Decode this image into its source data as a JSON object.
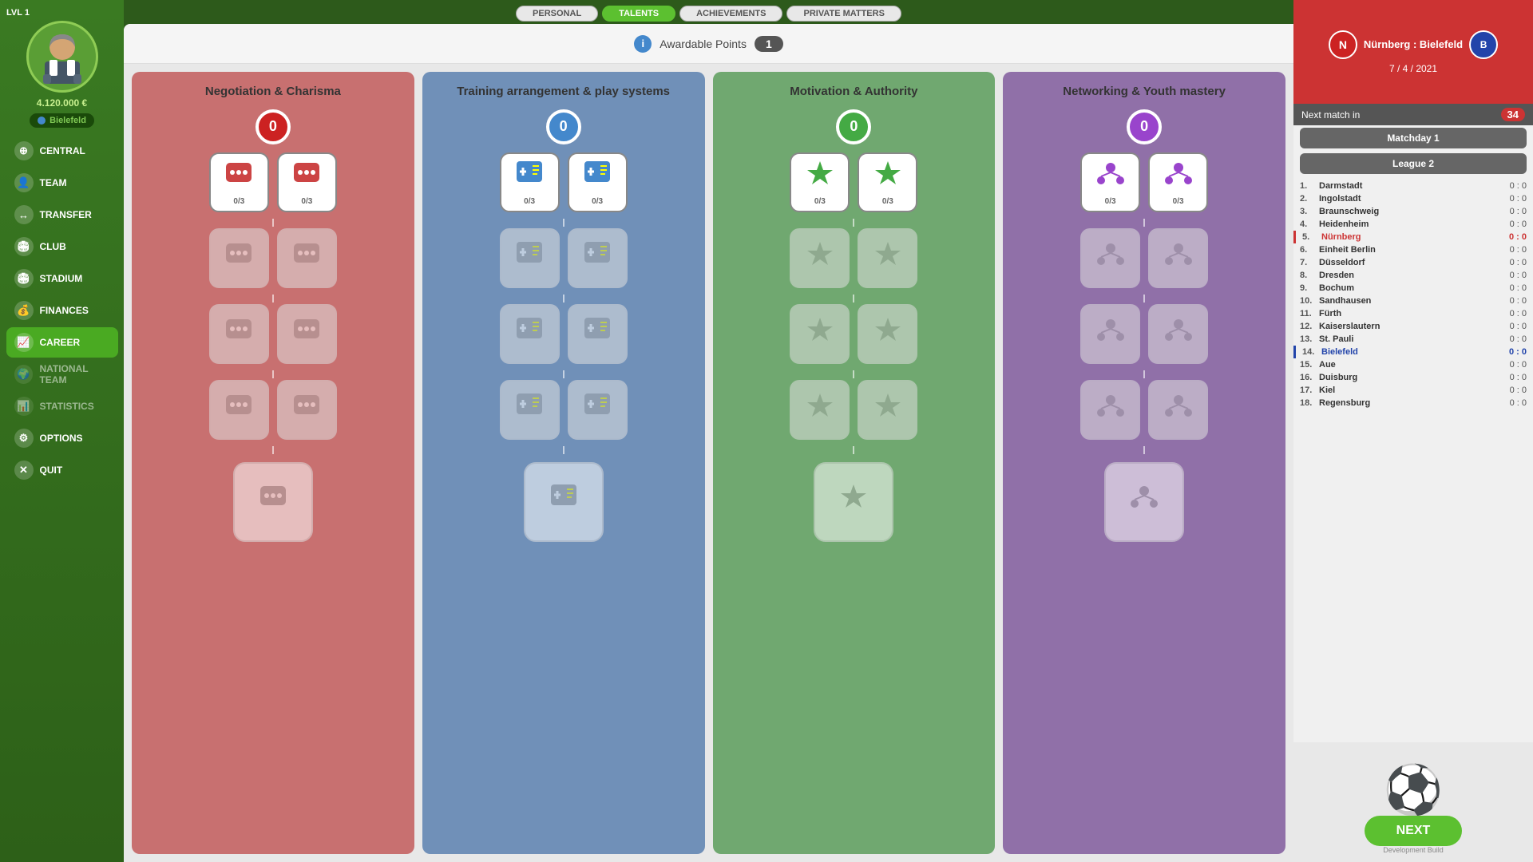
{
  "level": "LVL 1",
  "money": "4.120.000 €",
  "club": "Bielefeld",
  "topTabs": [
    "PERSONAL",
    "TALENTS",
    "ACHIEVEMENTS",
    "PRIVATE MATTERS"
  ],
  "activeTab": "TALENTS",
  "awardableLabel": "Awardable Points",
  "awardablePoints": "1",
  "columns": [
    {
      "id": "neg",
      "title1": "Negotiation",
      "title2": "& Charisma",
      "color": "red",
      "indicatorColor": "red-ind",
      "level": "0",
      "icon1": "💬",
      "icon2": "💬",
      "rows": [
        {
          "icons": [
            "💬",
            "💬"
          ],
          "actives": [
            true,
            true
          ],
          "progresses": [
            "0/3",
            "0/3"
          ]
        },
        {
          "icons": [
            "💬",
            "💬"
          ],
          "actives": [
            false,
            false
          ],
          "progresses": [
            "",
            ""
          ]
        },
        {
          "icons": [
            "💬",
            "💬"
          ],
          "actives": [
            false,
            false
          ],
          "progresses": [
            "",
            ""
          ]
        },
        {
          "icons": [
            "💬",
            "💬"
          ],
          "actives": [
            false,
            false
          ],
          "progresses": [
            "",
            ""
          ]
        }
      ],
      "bigIcon": "💬"
    },
    {
      "id": "train",
      "title1": "Training arrangement",
      "title2": "& play systems",
      "color": "blue",
      "indicatorColor": "blue-ind",
      "level": "0",
      "rows": [
        {
          "icons": [
            "⚡",
            "⚡"
          ],
          "actives": [
            true,
            true
          ],
          "progresses": [
            "0/3",
            "0/3"
          ]
        },
        {
          "icons": [
            "⚡",
            "⚡"
          ],
          "actives": [
            false,
            false
          ],
          "progresses": [
            "",
            ""
          ]
        },
        {
          "icons": [
            "⚡",
            "⚡"
          ],
          "actives": [
            false,
            false
          ],
          "progresses": [
            "",
            ""
          ]
        },
        {
          "icons": [
            "⚡",
            "⚡"
          ],
          "actives": [
            false,
            false
          ],
          "progresses": [
            "",
            ""
          ]
        }
      ],
      "bigIcon": "⚡"
    },
    {
      "id": "motiv",
      "title1": "Motivation",
      "title2": "& Authority",
      "color": "green",
      "indicatorColor": "green-ind",
      "level": "0",
      "rows": [
        {
          "icons": [
            "⭐",
            "⭐"
          ],
          "actives": [
            true,
            true
          ],
          "progresses": [
            "0/3",
            "0/3"
          ]
        },
        {
          "icons": [
            "⭐",
            "⭐"
          ],
          "actives": [
            false,
            false
          ],
          "progresses": [
            "",
            ""
          ]
        },
        {
          "icons": [
            "⭐",
            "⭐"
          ],
          "actives": [
            false,
            false
          ],
          "progresses": [
            "",
            ""
          ]
        },
        {
          "icons": [
            "⭐",
            "⭐"
          ],
          "actives": [
            false,
            false
          ],
          "progresses": [
            "",
            ""
          ]
        }
      ],
      "bigIcon": "⭐"
    },
    {
      "id": "net",
      "title1": "Networking",
      "title2": "& Youth mastery",
      "color": "purple",
      "indicatorColor": "purple-ind",
      "level": "0",
      "rows": [
        {
          "icons": [
            "👥",
            "👥"
          ],
          "actives": [
            true,
            true
          ],
          "progresses": [
            "0/3",
            "0/3"
          ]
        },
        {
          "icons": [
            "👥",
            "👥"
          ],
          "actives": [
            false,
            false
          ],
          "progresses": [
            "",
            ""
          ]
        },
        {
          "icons": [
            "👥",
            "👥"
          ],
          "actives": [
            false,
            false
          ],
          "progresses": [
            "",
            ""
          ]
        },
        {
          "icons": [
            "👥",
            "👥"
          ],
          "actives": [
            false,
            false
          ],
          "progresses": [
            "",
            ""
          ]
        }
      ],
      "bigIcon": "👥"
    }
  ],
  "nav": {
    "items": [
      {
        "label": "CENTRAL",
        "icon": "⊕",
        "active": false
      },
      {
        "label": "TEAM",
        "icon": "👤",
        "active": false
      },
      {
        "label": "TRANSFER",
        "icon": "↔",
        "active": false
      },
      {
        "label": "CLUB",
        "icon": "🏟",
        "active": false
      },
      {
        "label": "STADIUM",
        "icon": "🏟",
        "active": false
      },
      {
        "label": "FINANCES",
        "icon": "💰",
        "active": false
      },
      {
        "label": "CAREER",
        "icon": "📈",
        "active": true
      },
      {
        "label": "NATIONAL TEAM",
        "icon": "🌍",
        "active": false,
        "disabled": true
      },
      {
        "label": "STATISTICS",
        "icon": "📊",
        "active": false,
        "disabled": true
      },
      {
        "label": "OPTIONS",
        "icon": "⚙",
        "active": false
      },
      {
        "label": "QUIT",
        "icon": "✕",
        "active": false
      }
    ]
  },
  "right": {
    "matchName": "Nürnberg : Bielefeld",
    "date": "7 / 4 / 2021",
    "nextMatchLabel": "Next match in",
    "nextMatchCount": "34",
    "matchday": "Matchday 1",
    "league": "League 2",
    "leagueTable": [
      {
        "pos": "1.",
        "name": "Darmstadt",
        "score": "0 : 0",
        "cls": ""
      },
      {
        "pos": "2.",
        "name": "Ingolstadt",
        "score": "0 : 0",
        "cls": ""
      },
      {
        "pos": "3.",
        "name": "Braunschweig",
        "score": "0 : 0",
        "cls": ""
      },
      {
        "pos": "4.",
        "name": "Heidenheim",
        "score": "0 : 0",
        "cls": ""
      },
      {
        "pos": "5.",
        "name": "Nürnberg",
        "score": "0 : 0",
        "cls": "nurnberg"
      },
      {
        "pos": "6.",
        "name": "Einheit Berlin",
        "score": "0 : 0",
        "cls": ""
      },
      {
        "pos": "7.",
        "name": "Düsseldorf",
        "score": "0 : 0",
        "cls": ""
      },
      {
        "pos": "8.",
        "name": "Dresden",
        "score": "0 : 0",
        "cls": ""
      },
      {
        "pos": "9.",
        "name": "Bochum",
        "score": "0 : 0",
        "cls": ""
      },
      {
        "pos": "10.",
        "name": "Sandhausen",
        "score": "0 : 0",
        "cls": ""
      },
      {
        "pos": "11.",
        "name": "Fürth",
        "score": "0 : 0",
        "cls": ""
      },
      {
        "pos": "12.",
        "name": "Kaiserslautern",
        "score": "0 : 0",
        "cls": ""
      },
      {
        "pos": "13.",
        "name": "St. Pauli",
        "score": "0 : 0",
        "cls": ""
      },
      {
        "pos": "14.",
        "name": "Bielefeld",
        "score": "0 : 0",
        "cls": "bielefeld"
      },
      {
        "pos": "15.",
        "name": "Aue",
        "score": "0 : 0",
        "cls": ""
      },
      {
        "pos": "16.",
        "name": "Duisburg",
        "score": "0 : 0",
        "cls": ""
      },
      {
        "pos": "17.",
        "name": "Kiel",
        "score": "0 : 0",
        "cls": ""
      },
      {
        "pos": "18.",
        "name": "Regensburg",
        "score": "0 : 0",
        "cls": ""
      }
    ],
    "nextBtn": "NEXT",
    "devBuild": "Development Build"
  }
}
